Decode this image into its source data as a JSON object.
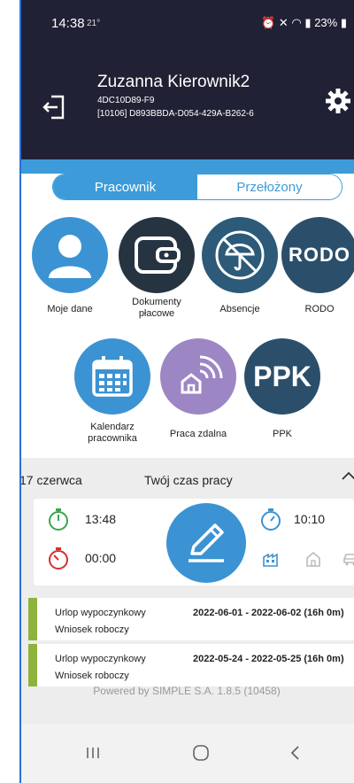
{
  "status_bar": {
    "time": "14:38",
    "temperature": "21°",
    "battery": "23%"
  },
  "header": {
    "name": "Zuzanna Kierownik2",
    "id_line": "4DC10D89-F9",
    "code_line": "[10106] D893BBDA-D054-429A-B262-6"
  },
  "toggle": {
    "employee": "Pracownik",
    "supervisor": "Przełożony"
  },
  "tiles": {
    "my_data": "Moje dane",
    "payroll_line1": "Dokumenty",
    "payroll_line2": "płacowe",
    "absences": "Absencje",
    "rodo": "RODO",
    "rodo_icon_text": "RODO",
    "calendar_line1": "Kalendarz",
    "calendar_line2": "pracownika",
    "remote": "Praca zdalna",
    "ppk": "PPK",
    "ppk_icon_text": "PPK"
  },
  "work_time": {
    "date": "17 czerwca",
    "title": "Twój czas pracy",
    "start_time": "13:48",
    "break_time": "00:00",
    "worked_time": "10:10"
  },
  "requests": [
    {
      "type": "Urlop wypoczynkowy",
      "status": "Wniosek roboczy",
      "dates": "2022-06-01 - 2022-06-02 (16h 0m)"
    },
    {
      "type": "Urlop wypoczynkowy",
      "status": "Wniosek roboczy",
      "dates": "2022-05-24 - 2022-05-25 (16h 0m)"
    }
  ],
  "footer": {
    "powered_by": "Powered by SIMPLE S.A. 1.8.5 (10458)"
  },
  "colors": {
    "header_bg": "#212135",
    "accent": "#3d9bd9",
    "request_bar": "#8db33a"
  }
}
